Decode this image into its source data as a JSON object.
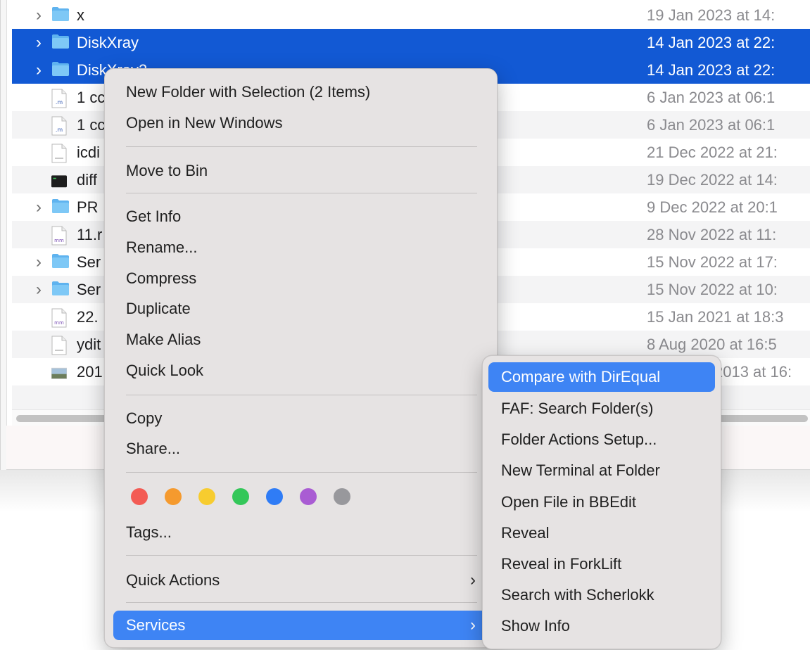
{
  "file_list": {
    "rows": [
      {
        "name": "x",
        "date": "19 Jan 2023 at 14:",
        "icon": "folder-icon",
        "disclosure": true,
        "selected": false
      },
      {
        "name": "DiskXray",
        "date": "14 Jan 2023 at 22:",
        "icon": "folder-icon",
        "disclosure": true,
        "selected": true
      },
      {
        "name": "DiskXray2",
        "date": "14 Jan 2023 at 22:",
        "icon": "folder-icon",
        "disclosure": true,
        "selected": true
      },
      {
        "name": "1 cc",
        "date": "6 Jan 2023 at 06:1",
        "icon": "m-file-icon",
        "disclosure": false,
        "selected": false
      },
      {
        "name": "1 cc",
        "date": "6 Jan 2023 at 06:1",
        "icon": "m-file-icon",
        "disclosure": false,
        "selected": false
      },
      {
        "name": "icdi",
        "date": "21 Dec 2022 at 21:",
        "icon": "text-file-icon",
        "disclosure": false,
        "selected": false
      },
      {
        "name": "diff",
        "date": "19 Dec 2022 at 14:",
        "icon": "terminal-file-icon",
        "disclosure": false,
        "selected": false
      },
      {
        "name": "PR",
        "date": "9 Dec 2022 at 20:1",
        "icon": "folder-icon",
        "disclosure": true,
        "selected": false
      },
      {
        "name": "11.r",
        "date": "28 Nov 2022 at 11:",
        "icon": "mm-file-icon",
        "disclosure": false,
        "selected": false
      },
      {
        "name": "Ser",
        "date": "15 Nov 2022 at 17:",
        "icon": "folder-icon",
        "disclosure": true,
        "selected": false
      },
      {
        "name": "Ser",
        "date": "15 Nov 2022 at 10:",
        "icon": "folder-icon",
        "disclosure": true,
        "selected": false
      },
      {
        "name": "22.",
        "date": "15 Jan 2021 at 18:3",
        "icon": "mm-file-icon",
        "disclosure": false,
        "selected": false
      },
      {
        "name": "ydit",
        "date": "8 Aug 2020 at 16:5",
        "icon": "text-file-icon",
        "disclosure": false,
        "selected": false
      },
      {
        "name": "201",
        "date": "2013 at 16:",
        "icon": "image-file-icon",
        "disclosure": false,
        "selected": false
      }
    ]
  },
  "context_menu": {
    "groups": [
      {
        "items": [
          {
            "label": "New Folder with Selection (2 Items)"
          },
          {
            "label": "Open in New Windows"
          }
        ]
      },
      {
        "items": [
          {
            "label": "Move to Bin"
          }
        ]
      },
      {
        "items": [
          {
            "label": "Get Info"
          },
          {
            "label": "Rename..."
          },
          {
            "label": "Compress"
          },
          {
            "label": "Duplicate"
          },
          {
            "label": "Make Alias"
          },
          {
            "label": "Quick Look"
          }
        ]
      },
      {
        "items": [
          {
            "label": "Copy"
          },
          {
            "label": "Share..."
          }
        ]
      }
    ],
    "tags": {
      "colors": [
        "#f35b54",
        "#f59a2e",
        "#f7cc2f",
        "#34c759",
        "#2f7cf6",
        "#a95cd3",
        "#98989c"
      ],
      "label": "Tags..."
    },
    "quick_actions": {
      "label": "Quick Actions",
      "chevron": "chevron-right-icon"
    },
    "services": {
      "label": "Services",
      "chevron": "chevron-right-icon",
      "highlighted": true
    }
  },
  "services_submenu": {
    "items": [
      {
        "label": "Compare with DirEqual",
        "highlighted": true
      },
      {
        "label": "FAF: Search Folder(s)"
      },
      {
        "label": "Folder Actions Setup..."
      },
      {
        "label": "New Terminal at Folder"
      },
      {
        "label": "Open File in BBEdit"
      },
      {
        "label": "Reveal"
      },
      {
        "label": "Reveal in ForkLift"
      },
      {
        "label": "Search with Scherlokk"
      },
      {
        "label": "Show Info"
      }
    ]
  },
  "colors": {
    "selection": "#1259d4",
    "menu_highlight": "#3e84f4",
    "menu_background": "#e6e3e3"
  }
}
